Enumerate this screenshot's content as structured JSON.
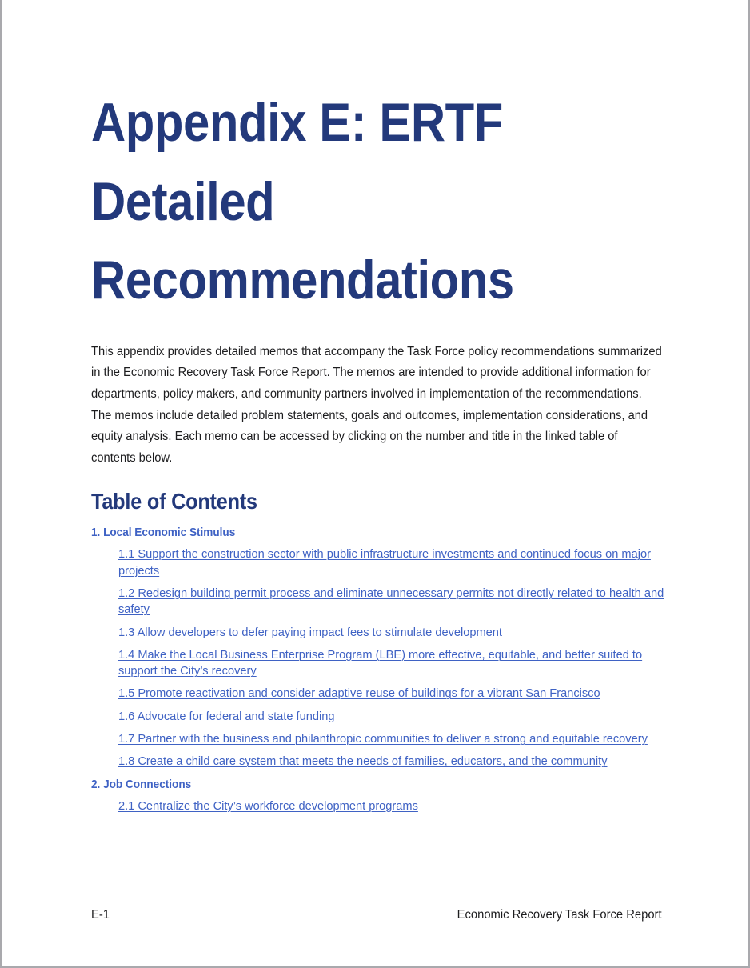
{
  "colors": {
    "title_navy": "#23397b",
    "link_blue": "#3f62c4",
    "body_text": "#1d1d1f",
    "page_border": "#a9a9ad",
    "page_background": "#ffffff"
  },
  "document": {
    "title": "Appendix E: ERTF Detailed Recommendations",
    "intro": "This appendix provides detailed memos that accompany the Task Force policy recommendations summarized in the Economic Recovery Task Force Report. The memos are intended to provide additional information for departments, policy makers, and community partners involved in implementation of the recommendations. The memos include detailed problem statements, goals and outcomes, implementation considerations, and equity analysis. Each memo can be accessed by clicking on the number and title in the linked table of contents below."
  },
  "toc": {
    "heading": "Table of Contents",
    "sections": [
      {
        "label": "1. Local Economic Stimulus",
        "entries": [
          "1.1 Support the construction sector with public infrastructure investments and continued focus on major projects",
          "1.2 Redesign building permit process and eliminate unnecessary permits not directly related to health and safety",
          "1.3 Allow developers to defer paying impact fees to stimulate development",
          "1.4 Make the Local Business Enterprise Program (LBE) more effective, equitable, and better suited to support the City’s recovery",
          "1.5 Promote reactivation and consider adaptive reuse of buildings for a vibrant San Francisco",
          "1.6 Advocate for federal and state funding",
          "1.7 Partner with the business and philanthropic communities to deliver a strong and equitable recovery",
          "1.8 Create a child care system that meets the needs of families, educators, and the community"
        ]
      },
      {
        "label": "2. Job Connections",
        "entries": [
          "2.1 Centralize the City’s workforce development programs"
        ]
      }
    ]
  },
  "footer": {
    "page_number": "E-1",
    "document_name": "Economic Recovery Task Force Report"
  }
}
